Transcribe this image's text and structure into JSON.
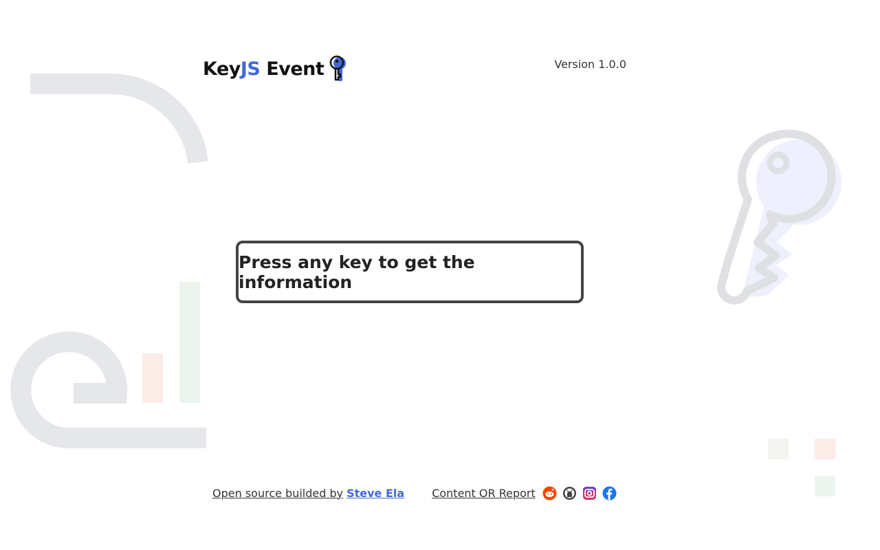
{
  "header": {
    "brand_prefix": "Key",
    "brand_accent": "JS",
    "brand_suffix": " Event",
    "version": "Version 1.0.0"
  },
  "prompt": {
    "text": "Press any key to get the information"
  },
  "footer": {
    "credit_prefix": "Open source builded by",
    "author": "Steve Ela",
    "report": "Content OR Report",
    "social_icons": [
      "reddit-icon",
      "github-icon",
      "instagram-icon",
      "facebook-icon"
    ]
  },
  "colors": {
    "accent": "#4169d8",
    "box_border": "#444444",
    "deco_gray": "#e5e7ea",
    "reddit": "#ff4500",
    "facebook": "#1877f2"
  }
}
